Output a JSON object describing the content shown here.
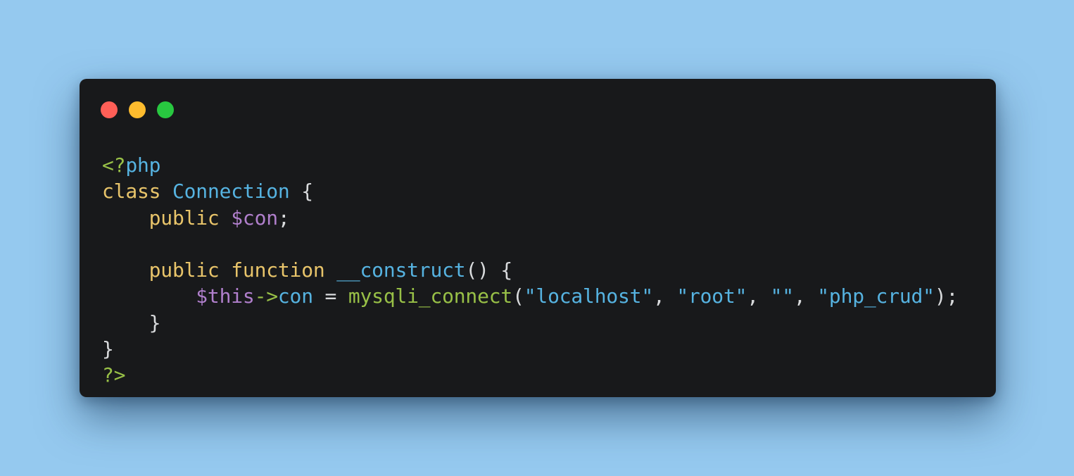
{
  "colors": {
    "background": "#95c9ef",
    "window": "#18191b",
    "close": "#ff5f57",
    "minimize": "#febc2e",
    "maximize": "#28c840"
  },
  "window_controls": [
    "close-dot",
    "minimize-dot",
    "maximize-dot"
  ],
  "code": {
    "line1": {
      "open_tag_lt": "<?",
      "open_tag_php": "php"
    },
    "line2": {
      "kw_class": "class",
      "sp1": " ",
      "class_name": "Connection",
      "sp2": " ",
      "brace": "{"
    },
    "line3": {
      "indent": "    ",
      "kw_public": "public",
      "sp1": " ",
      "var": "$con",
      "semi": ";"
    },
    "line4": {
      "blank": " "
    },
    "line5": {
      "indent": "    ",
      "kw_public": "public",
      "sp1": " ",
      "kw_function": "function",
      "sp2": " ",
      "fn_name": "__construct",
      "parens": "() {"
    },
    "line6": {
      "indent": "        ",
      "this": "$this",
      "arrow": "->",
      "prop": "con",
      "assign": " = ",
      "call": "mysqli_connect",
      "open": "(",
      "arg1": "\"localhost\"",
      "c1": ", ",
      "arg2": "\"root\"",
      "c2": ", ",
      "arg3": "\"\"",
      "c3": ", ",
      "arg4": "\"php_crud\"",
      "close": ");"
    },
    "line7": {
      "indent": "    ",
      "brace": "}"
    },
    "line8": {
      "brace": "}"
    },
    "line9": {
      "close_tag": "?>"
    }
  }
}
